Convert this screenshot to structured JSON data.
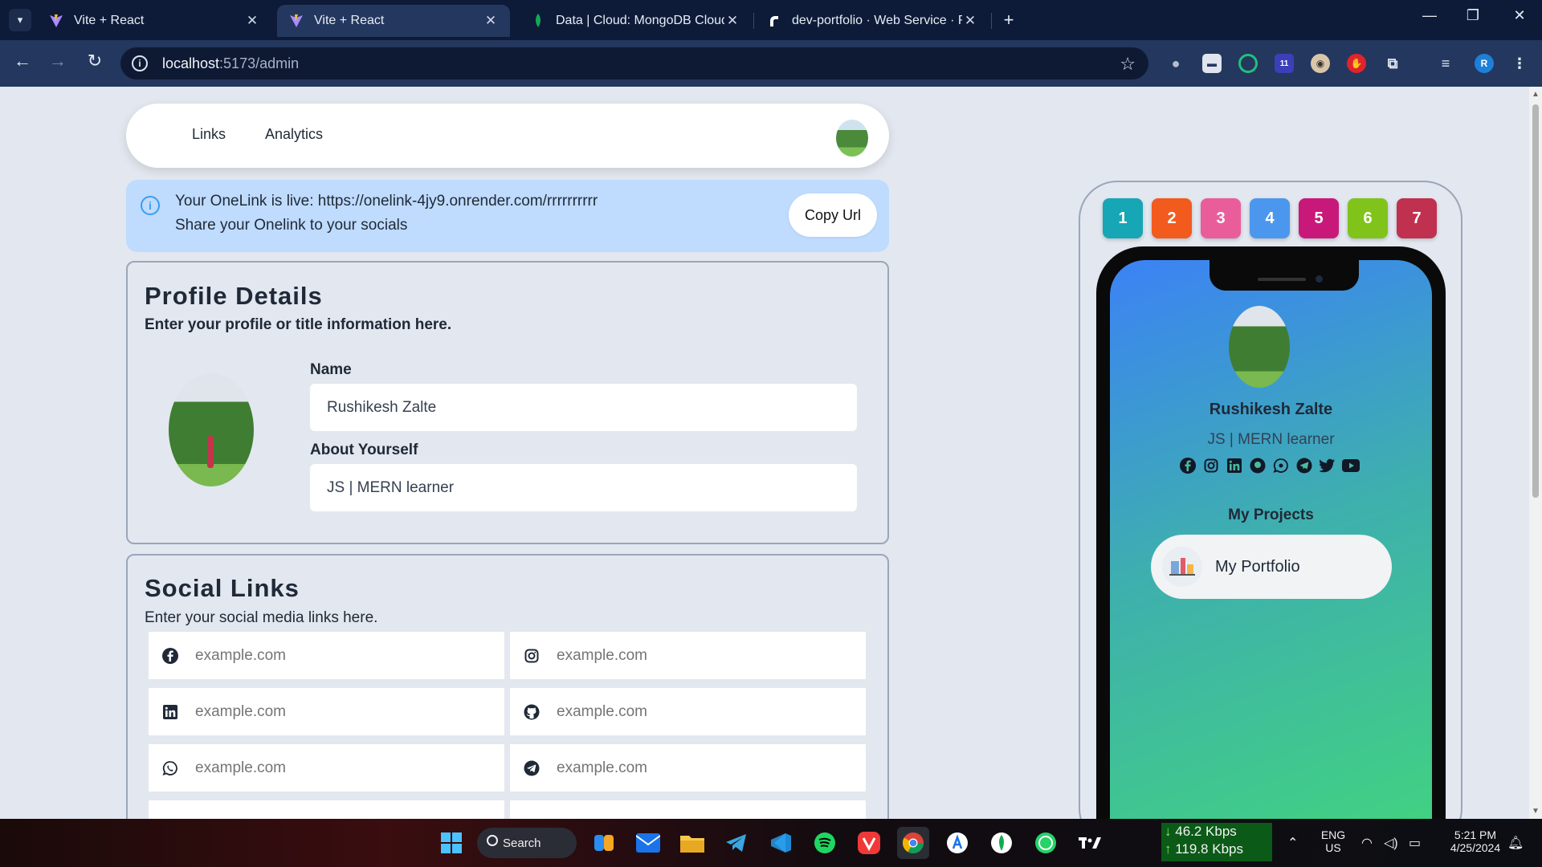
{
  "browser": {
    "tabs": [
      {
        "title": "Vite + React",
        "favicon": "vite-icon"
      },
      {
        "title": "Vite + React",
        "favicon": "vite-icon"
      },
      {
        "title": "Data | Cloud: MongoDB Cloud",
        "favicon": "mongodb-leaf-icon"
      },
      {
        "title": "dev-portfolio · Web Service · R",
        "favicon": "render-icon"
      }
    ],
    "url_host": "localhost",
    "url_path": ":5173/admin",
    "profile_initial": "R",
    "ext_badge": "11"
  },
  "nav": {
    "links_label": "Links",
    "analytics_label": "Analytics"
  },
  "alert": {
    "line1": "Your OneLink is live: https://onelink-4jy9.onrender.com/rrrrrrrrrr",
    "line2": "Share your Onelink to your socials",
    "copy_label": "Copy Url"
  },
  "profile": {
    "title": "Profile Details",
    "subtitle": "Enter your profile or title information here.",
    "name_label": "Name",
    "name_value": "Rushikesh Zalte",
    "about_label": "About Yourself",
    "about_value": "JS | MERN learner"
  },
  "social": {
    "title": "Social Links",
    "subtitle": "Enter your social media links here.",
    "fields": [
      {
        "icon": "facebook-icon",
        "placeholder": "example.com"
      },
      {
        "icon": "instagram-icon",
        "placeholder": "example.com"
      },
      {
        "icon": "linkedin-icon",
        "placeholder": "example.com"
      },
      {
        "icon": "github-icon",
        "placeholder": "example.com"
      },
      {
        "icon": "whatsapp-icon",
        "placeholder": "example.com"
      },
      {
        "icon": "telegram-icon",
        "placeholder": "example.com"
      }
    ]
  },
  "themes": {
    "labels": [
      "1",
      "2",
      "3",
      "4",
      "5",
      "6",
      "7"
    ],
    "colors": [
      "#16a6b6",
      "#f25a1e",
      "#ea5d9b",
      "#4b97ee",
      "#c8197a",
      "#80c41b",
      "#c0304f"
    ]
  },
  "preview": {
    "name": "Rushikesh Zalte",
    "about": "JS | MERN learner",
    "projects_title": "My Projects",
    "project_label": "My Portfolio",
    "social_icons": [
      "facebook-icon",
      "instagram-icon",
      "linkedin-icon",
      "github-icon",
      "whatsapp-icon",
      "telegram-icon",
      "twitter-icon",
      "youtube-icon"
    ]
  },
  "taskbar": {
    "search_label": "Search",
    "net_down": "46.2 Kbps",
    "net_up": "119.8 Kbps",
    "lang": "ENG",
    "region": "US",
    "time": "5:21 PM",
    "date": "4/25/2024"
  }
}
